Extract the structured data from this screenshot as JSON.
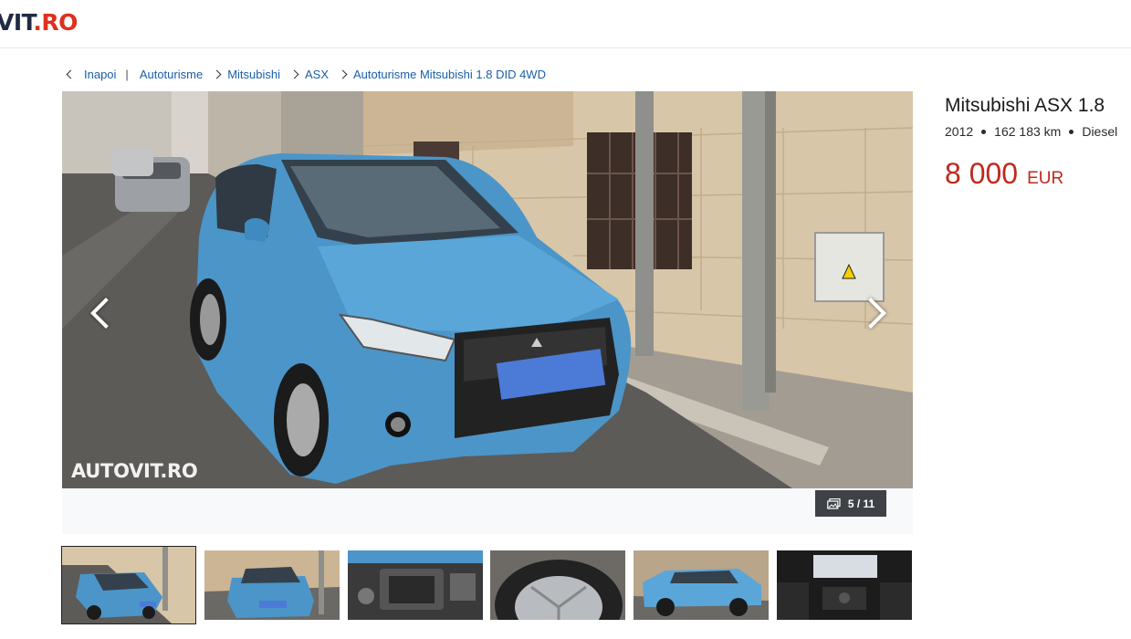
{
  "header": {
    "logo_main": "VIT",
    "logo_accent": ".RO"
  },
  "breadcrumb": {
    "back_label": "Inapoi",
    "separator": "|",
    "items": [
      "Autoturisme",
      "Mitsubishi",
      "ASX",
      "Autoturisme Mitsubishi 1.8 DID 4WD"
    ]
  },
  "gallery": {
    "watermark": "AUTOVIT.RO",
    "counter": "5 / 11",
    "current_index": 5,
    "total": 11,
    "icons": {
      "prev": "chevron-left-icon",
      "next": "chevron-right-icon",
      "counter": "gallery-icon"
    }
  },
  "listing": {
    "title": "Mitsubishi ASX 1.8",
    "year": "2012",
    "mileage": "162 183 km",
    "fuel": "Diesel",
    "price_amount": "8 000",
    "price_currency": "EUR"
  },
  "colors": {
    "price": "#c0281d",
    "link": "#1a5fa8",
    "logo_accent": "#e0301e"
  },
  "thumbnails": [
    "thumb-1",
    "thumb-2",
    "thumb-3",
    "thumb-4",
    "thumb-5",
    "thumb-6"
  ]
}
